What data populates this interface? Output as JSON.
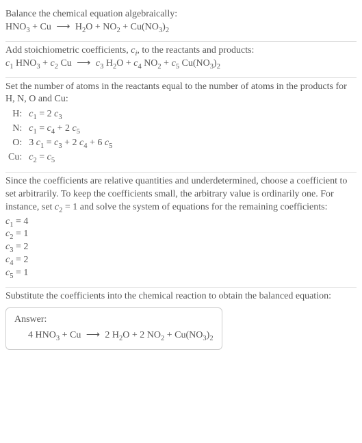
{
  "section1": {
    "line1": "Balance the chemical equation algebraically:",
    "eq": {
      "lhs1": "HNO",
      "lhs1_sub": "3",
      "plus1": " + Cu ",
      "arrow": "⟶",
      "rhs1": " H",
      "rhs1_sub": "2",
      "rhs1b": "O + NO",
      "rhs1b_sub": "2",
      "plus2": " + Cu(NO",
      "plus2_sub": "3",
      "plus2b": ")",
      "plus2b_sub": "2"
    }
  },
  "section2": {
    "line1a": "Add stoichiometric coefficients, ",
    "ci": "c",
    "ci_sub": "i",
    "line1b": ", to the reactants and products:",
    "eq": {
      "c1": "c",
      "c1_s": "1",
      "t1": " HNO",
      "t1_s": "3",
      "p1": " + ",
      "c2": "c",
      "c2_s": "2",
      "t2": " Cu ",
      "arrow": "⟶",
      "c3": " c",
      "c3_s": "3",
      "t3": " H",
      "t3_s": "2",
      "t3b": "O + ",
      "c4": "c",
      "c4_s": "4",
      "t4": " NO",
      "t4_s": "2",
      "p2": " + ",
      "c5": "c",
      "c5_s": "5",
      "t5": " Cu(NO",
      "t5_s": "3",
      "t5b": ")",
      "t5b_s": "2"
    }
  },
  "section3": {
    "line1": "Set the number of atoms in the reactants equal to the number of atoms in the products for H, N, O and Cu:",
    "rows": [
      {
        "el": "H:",
        "eq_a": "c",
        "eq_a_s": "1",
        "eq_mid": " = 2 ",
        "eq_b": "c",
        "eq_b_s": "3",
        "rest": ""
      },
      {
        "el": "N:",
        "eq_a": "c",
        "eq_a_s": "1",
        "eq_mid": " = ",
        "eq_b": "c",
        "eq_b_s": "4",
        "rest_a": " + 2 ",
        "rest_b": "c",
        "rest_b_s": "5"
      },
      {
        "el": "O:",
        "eq_pre": "3 ",
        "eq_a": "c",
        "eq_a_s": "1",
        "eq_mid": " = ",
        "eq_b": "c",
        "eq_b_s": "3",
        "rest_a": " + 2 ",
        "rest_b": "c",
        "rest_b_s": "4",
        "rest_c": " + 6 ",
        "rest_d": "c",
        "rest_d_s": "5"
      },
      {
        "el": "Cu:",
        "eq_a": "c",
        "eq_a_s": "2",
        "eq_mid": " = ",
        "eq_b": "c",
        "eq_b_s": "5",
        "rest": ""
      }
    ]
  },
  "section4": {
    "para_a": "Since the coefficients are relative quantities and underdetermined, choose a coefficient to set arbitrarily. To keep the coefficients small, the arbitrary value is ordinarily one. For instance, set ",
    "c2": "c",
    "c2_s": "2",
    "para_b": " = 1 and solve the system of equations for the remaining coefficients:",
    "coeffs": [
      {
        "c": "c",
        "s": "1",
        "v": " = 4"
      },
      {
        "c": "c",
        "s": "2",
        "v": " = 1"
      },
      {
        "c": "c",
        "s": "3",
        "v": " = 2"
      },
      {
        "c": "c",
        "s": "4",
        "v": " = 2"
      },
      {
        "c": "c",
        "s": "5",
        "v": " = 1"
      }
    ]
  },
  "section5": {
    "line1": "Substitute the coefficients into the chemical reaction to obtain the balanced equation:",
    "answer_label": "Answer:",
    "eq": {
      "a": "4 HNO",
      "a_s": "3",
      "b": " + Cu ",
      "arrow": "⟶",
      "c": " 2 H",
      "c_s": "2",
      "c2": "O + 2 NO",
      "c2_s": "2",
      "d": " + Cu(NO",
      "d_s": "3",
      "d2": ")",
      "d2_s": "2"
    }
  }
}
